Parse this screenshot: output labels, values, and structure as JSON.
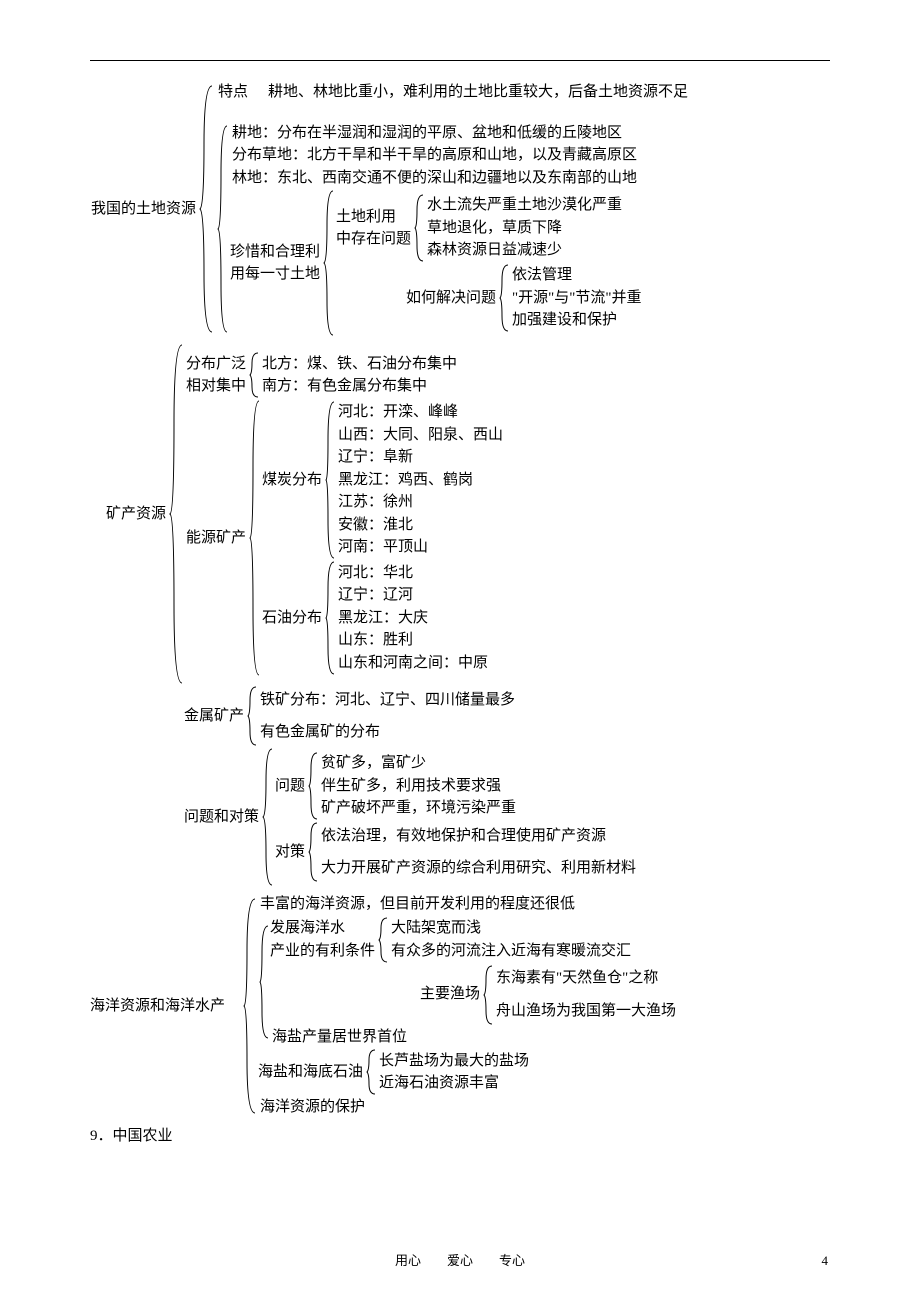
{
  "land": {
    "root": "我国的土地资源",
    "feature_label": "特点",
    "feature_text": "耕地、林地比重小，难利用的土地比重较大，后备土地资源不足",
    "dist": [
      "耕地：分布在半湿润和湿润的平原、盆地和低缓的丘陵地区",
      "分布草地：北方干旱和半干旱的高原和山地，以及青藏高原区",
      "林地：东北、西南交通不便的深山和边疆地以及东南部的山地"
    ],
    "conserve": [
      "珍惜和合理利",
      "用每一寸土地"
    ],
    "use_label": [
      "土地利用",
      "中存在问题"
    ],
    "use_items": [
      "水土流失严重土地沙漠化严重",
      "草地退化，草质下降",
      "森林资源日益减速少"
    ],
    "solve_label": "如何解决问题",
    "solve_items": [
      "依法管理",
      "\"开源\"与\"节流\"并重",
      "加强建设和保护"
    ]
  },
  "mineral": {
    "root": "矿产资源",
    "dist_label": [
      "分布广泛",
      "相对集中"
    ],
    "dist_items": [
      "北方：煤、铁、石油分布集中",
      "南方：有色金属分布集中"
    ],
    "energy_label": "能源矿产",
    "coal_label": "煤炭分布",
    "coal_items": [
      "河北：开滦、峰峰",
      "山西：大同、阳泉、西山",
      "辽宁：阜新",
      "黑龙江：鸡西、鹤岗",
      "江苏：徐州",
      "安徽：淮北",
      "河南：平顶山"
    ],
    "oil_label": "石油分布",
    "oil_items": [
      "河北：华北",
      "辽宁：辽河",
      "黑龙江：大庆",
      "山东：胜利",
      "山东和河南之间：中原"
    ],
    "metal_label": "金属矿产",
    "metal_items": [
      "铁矿分布：河北、辽宁、四川储量最多",
      "",
      "有色金属矿的分布"
    ],
    "issue_root": "问题和对策",
    "issue_label": "问题",
    "issue_items": [
      "贫矿多，富矿少",
      "伴生矿多，利用技术要求强",
      "矿产破坏严重，环境污染严重"
    ],
    "policy_label": "对策",
    "policy_items": [
      "依法治理，有效地保护和合理使用矿产资源",
      "",
      "大力开展矿产资源的综合利用研究、利用新材料"
    ]
  },
  "ocean": {
    "root": "海洋资源和海洋水产",
    "rich": "丰富的海洋资源，但目前开发利用的程度还很低",
    "dev_label": [
      "发展海洋水",
      "产业的有利条件"
    ],
    "dev_items": [
      "大陆架宽而浅",
      "有众多的河流注入近海有寒暖流交汇"
    ],
    "fishery_label": "主要渔场",
    "fishery_items": [
      "东海素有\"天然鱼仓\"之称",
      "",
      "舟山渔场为我国第一大渔场"
    ],
    "salt_top": "海盐产量居世界首位",
    "salt_label": "海盐和海底石油",
    "salt_items": [
      "长芦盐场为最大的盐场",
      "近海石油资源丰富"
    ],
    "protect": "海洋资源的保护"
  },
  "section9": "9．中国农业",
  "footer": {
    "text": "用心　　爱心　　专心",
    "page": "4"
  }
}
